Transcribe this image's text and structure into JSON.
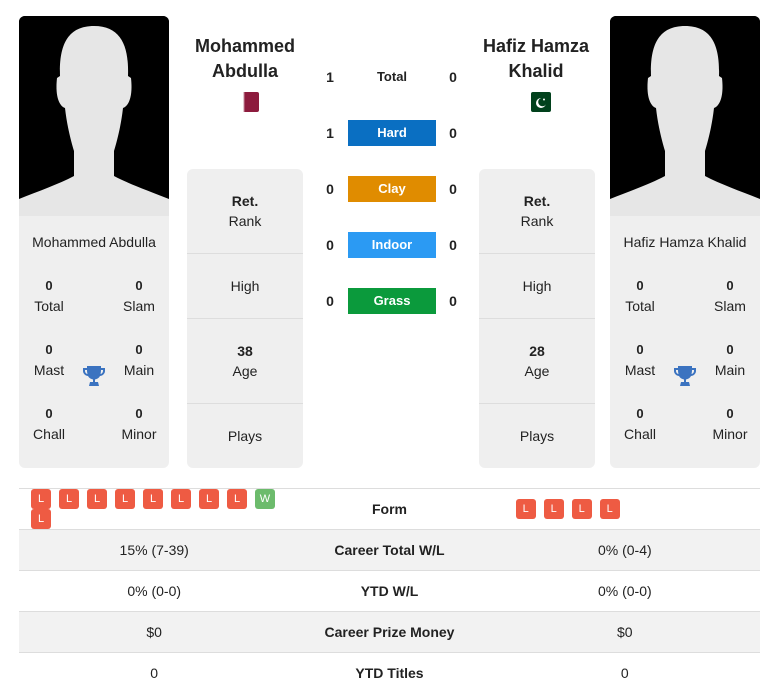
{
  "player1": {
    "name": "Mohammed Abdulla",
    "title_line1": "Mohammed",
    "title_line2": "Abdulla",
    "flag": "qatar-flag",
    "flag_color": "#8d1b3d",
    "stats": {
      "total": {
        "value": "0",
        "label": "Total"
      },
      "slam": {
        "value": "0",
        "label": "Slam"
      },
      "mast": {
        "value": "0",
        "label": "Mast"
      },
      "main": {
        "value": "0",
        "label": "Main"
      },
      "chall": {
        "value": "0",
        "label": "Chall"
      },
      "minor": {
        "value": "0",
        "label": "Minor"
      }
    },
    "rank": {
      "value": "Ret.",
      "label": "Rank"
    },
    "high": {
      "label": "High"
    },
    "age": {
      "value": "38",
      "label": "Age"
    },
    "plays": {
      "label": "Plays"
    }
  },
  "player2": {
    "name": "Hafiz Hamza Khalid",
    "title_line1": "Hafiz Hamza",
    "title_line2": "Khalid",
    "flag": "pakistan-flag",
    "flag_color": "#01411c",
    "stats": {
      "total": {
        "value": "0",
        "label": "Total"
      },
      "slam": {
        "value": "0",
        "label": "Slam"
      },
      "mast": {
        "value": "0",
        "label": "Mast"
      },
      "main": {
        "value": "0",
        "label": "Main"
      },
      "chall": {
        "value": "0",
        "label": "Chall"
      },
      "minor": {
        "value": "0",
        "label": "Minor"
      }
    },
    "rank": {
      "value": "Ret.",
      "label": "Rank"
    },
    "high": {
      "label": "High"
    },
    "age": {
      "value": "28",
      "label": "Age"
    },
    "plays": {
      "label": "Plays"
    }
  },
  "h2h": [
    {
      "label": "Total",
      "p1": "1",
      "p2": "0",
      "color": ""
    },
    {
      "label": "Hard",
      "p1": "1",
      "p2": "0",
      "color": "#0a6fc2"
    },
    {
      "label": "Clay",
      "p1": "0",
      "p2": "0",
      "color": "#e08c00"
    },
    {
      "label": "Indoor",
      "p1": "0",
      "p2": "0",
      "color": "#2b9af3"
    },
    {
      "label": "Grass",
      "p1": "0",
      "p2": "0",
      "color": "#0b9a3c"
    }
  ],
  "comparison": {
    "form_label": "Form",
    "p1_form": [
      "L",
      "L",
      "L",
      "L",
      "L",
      "L",
      "L",
      "L",
      "W",
      "L"
    ],
    "p2_form": [
      "L",
      "L",
      "L",
      "L"
    ],
    "rows": [
      {
        "label": "Career Total W/L",
        "p1": "15% (7-39)",
        "p2": "0% (0-4)"
      },
      {
        "label": "YTD W/L",
        "p1": "0% (0-0)",
        "p2": "0% (0-0)"
      },
      {
        "label": "Career Prize Money",
        "p1": "$0",
        "p2": "$0"
      },
      {
        "label": "YTD Titles",
        "p1": "0",
        "p2": "0"
      }
    ]
  }
}
